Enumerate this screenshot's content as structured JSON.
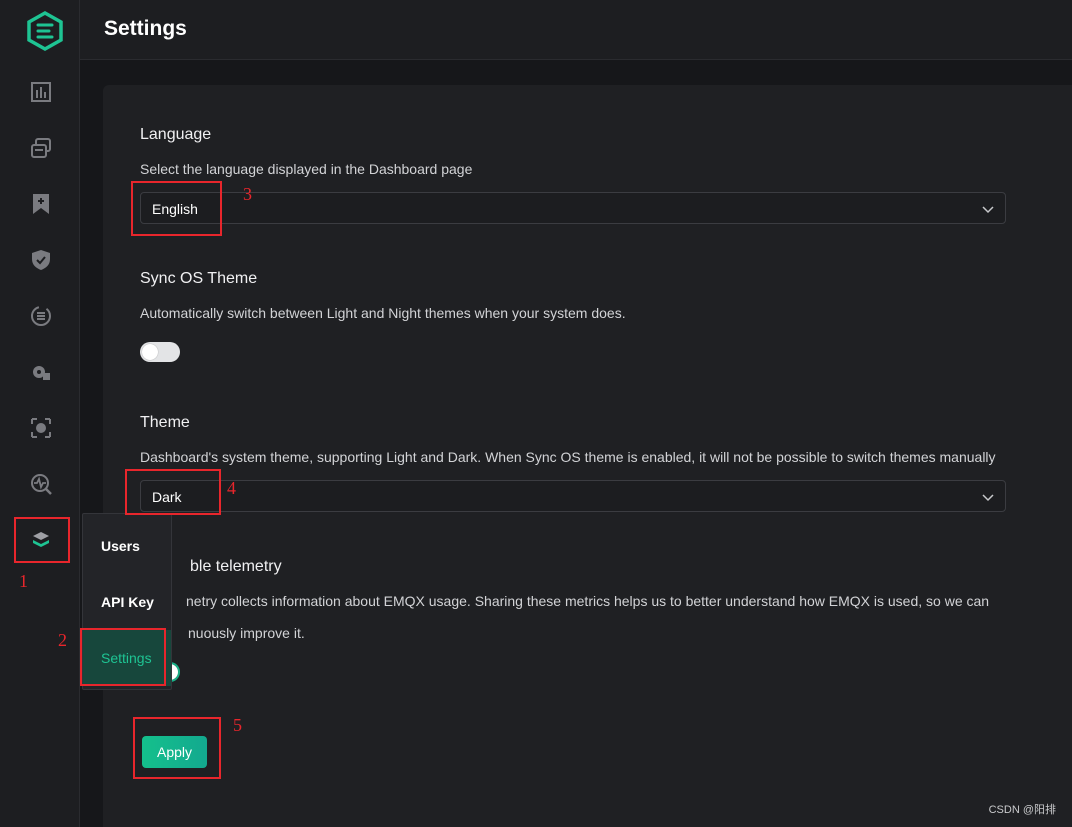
{
  "header": {
    "title": "Settings"
  },
  "language": {
    "title": "Language",
    "description": "Select the language displayed in the Dashboard page",
    "value": "English"
  },
  "sync_os_theme": {
    "title": "Sync OS Theme",
    "description": "Automatically switch between Light and Night themes when your system does.",
    "enabled": false
  },
  "theme": {
    "title": "Theme",
    "description": "Dashboard's system theme, supporting Light and Dark. When Sync OS theme is enabled, it will not be possible to switch themes manually",
    "value": "Dark"
  },
  "telemetry": {
    "title": "ble telemetry",
    "description_line1": "netry collects information about EMQX usage. Sharing these metrics helps us to better understand how EMQX is used, so we can",
    "description_line2": "nuously improve it.",
    "enabled": true
  },
  "apply_label": "Apply",
  "submenu": {
    "items": [
      {
        "label": "Users"
      },
      {
        "label": "API Key"
      },
      {
        "label": "Settings"
      }
    ]
  },
  "annotations": [
    "1",
    "2",
    "3",
    "4",
    "5"
  ],
  "watermark": "CSDN @阳排",
  "colors": {
    "accent": "#1ec493",
    "annotation": "#e8262c",
    "background": "#16171a"
  },
  "icons": {
    "sidebar": [
      "logo-icon",
      "dashboard-icon",
      "clients-icon",
      "bookmark-icon",
      "shield-icon",
      "integration-icon",
      "plugin-icon",
      "extension-icon",
      "diagnose-icon",
      "system-icon"
    ]
  }
}
